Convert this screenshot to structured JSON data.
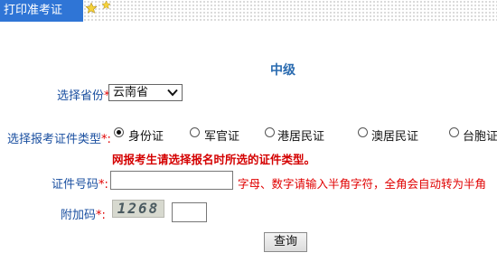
{
  "header": {
    "tab_label": "打印准考证"
  },
  "form": {
    "heading": "中级",
    "province": {
      "label": "选择省份",
      "required_mark": "*:",
      "value": "云南省"
    },
    "id_type": {
      "label": "选择报考证件类型",
      "required_mark": "*:",
      "options": [
        "身份证",
        "军官证",
        "港居民证",
        "澳居民证",
        "台胞证"
      ],
      "selected_index": 0
    },
    "warning": "网报考生请选择报名时所选的证件类型。",
    "id_number": {
      "label": "证件号码",
      "required_mark": "*:",
      "value": "",
      "hint": "字母、数字请输入半角字符，全角会自动转为半角"
    },
    "captcha": {
      "label": "附加码",
      "required_mark": "*:",
      "image_text": "1268",
      "value": ""
    },
    "submit_label": "查询"
  },
  "colors": {
    "tab_bg": "#2f75d6",
    "label": "#1a4fa0",
    "required": "#e00000",
    "heading": "#2a6bb0"
  }
}
